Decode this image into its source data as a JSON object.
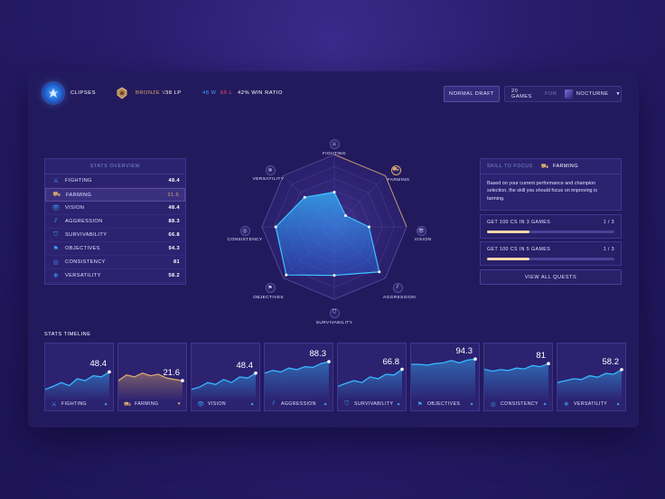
{
  "header": {
    "username": "CLIPSES",
    "rank": "BRONZE V",
    "lp": "38 LP",
    "wins": "48 W",
    "losses": "65 L",
    "win_ratio": "42% WIN RATIO",
    "draft_button": "NORMAL DRAFT",
    "games_button": "20 GAMES",
    "for_label": "FOR",
    "champion": "NOCTURNE"
  },
  "overview": {
    "title": "STATS OVERVIEW",
    "rows": [
      {
        "label": "FIGHTING",
        "value": "48.4",
        "icon": "sword-icon"
      },
      {
        "label": "FARMING",
        "value": "21.6",
        "icon": "farming-icon"
      },
      {
        "label": "VISION",
        "value": "48.4",
        "icon": "eye-icon"
      },
      {
        "label": "AGGRESSION",
        "value": "88.3",
        "icon": "claw-icon"
      },
      {
        "label": "SURVIVABILITY",
        "value": "66.8",
        "icon": "shield-icon"
      },
      {
        "label": "OBJECTIVES",
        "value": "94.3",
        "icon": "flag-icon"
      },
      {
        "label": "CONSISTENCY",
        "value": "81",
        "icon": "target-icon"
      },
      {
        "label": "VERSATILITY",
        "value": "58.2",
        "icon": "snowflake-icon"
      }
    ]
  },
  "radar": {
    "labels": [
      "FIGHTING",
      "FARMING",
      "VISION",
      "AGGRESSION",
      "SURVIVABILITY",
      "OBJECTIVES",
      "CONSISTENCY",
      "VERSATILITY"
    ],
    "values": [
      0.48,
      0.22,
      0.48,
      0.88,
      0.67,
      0.94,
      0.81,
      0.58
    ],
    "colors": {
      "accent": "#2fb4ff",
      "farming": "#d9a66b"
    }
  },
  "focus": {
    "title": "SKILL TO FOCUS",
    "skill": "FARMING",
    "description": "Based on your current performance and champion selection, the skill you should focus on improving is farming.",
    "quests": [
      {
        "label": "GET 100 CS IN 3 GAMES",
        "progress": "1 / 3",
        "fraction": 0.33
      },
      {
        "label": "GET 100 CS IN 5 GAMES",
        "progress": "1 / 3",
        "fraction": 0.33
      }
    ],
    "view_all": "VIEW ALL QUESTS"
  },
  "timeline": {
    "title": "STATS TIMELINE",
    "cards": [
      {
        "label": "FIGHTING",
        "value": "48.4"
      },
      {
        "label": "FARMING",
        "value": "21.6"
      },
      {
        "label": "VISION",
        "value": "48.4"
      },
      {
        "label": "AGGRESSION",
        "value": "88.3"
      },
      {
        "label": "SURVIVABILITY",
        "value": "66.8"
      },
      {
        "label": "OBJECTIVES",
        "value": "94.3"
      },
      {
        "label": "CONSISTENCY",
        "value": "81"
      },
      {
        "label": "VERSATILITY",
        "value": "58.2"
      }
    ]
  }
}
